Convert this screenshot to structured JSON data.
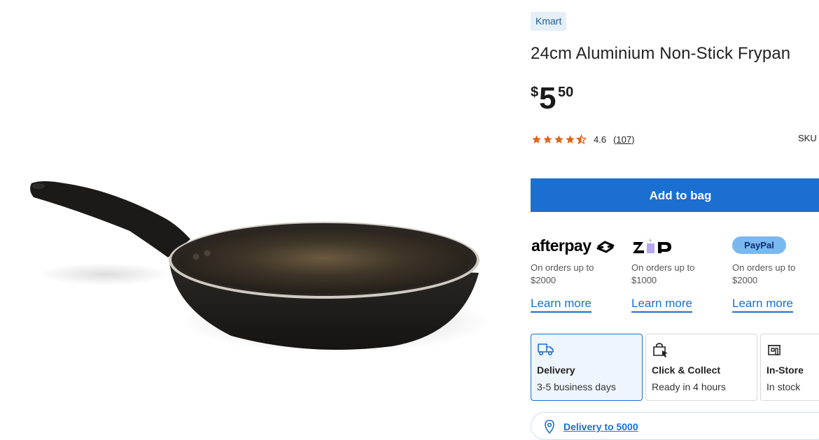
{
  "product": {
    "brand": "Kmart",
    "title": "24cm Aluminium Non-Stick Frypan",
    "price": {
      "currency": "$",
      "dollars": "5",
      "cents": "50"
    },
    "rating": {
      "score": "4.6",
      "count": "(107)",
      "stars": 4.5
    },
    "sku_label": "SKU :",
    "image_alt": "frypan-image"
  },
  "actions": {
    "add_to_bag": "Add to bag"
  },
  "payments": [
    {
      "logo": "afterpay",
      "logo_text": "afterpay",
      "desc": "On orders up to $2000",
      "learn": "Learn more"
    },
    {
      "logo": "zip",
      "logo_text": "zip",
      "desc": "On orders up to $1000",
      "learn": "Learn more"
    },
    {
      "logo": "paypal",
      "logo_text": "PayPal",
      "desc": "On orders up to $2000",
      "learn": "Learn more"
    }
  ],
  "delivery_options": [
    {
      "icon": "truck-icon",
      "title": "Delivery",
      "subtitle": "3-5 business days",
      "selected": true
    },
    {
      "icon": "bag-cursor-icon",
      "title": "Click & Collect",
      "subtitle": "Ready in 4 hours",
      "selected": false
    },
    {
      "icon": "store-icon",
      "title": "In-Store",
      "subtitle": "In stock",
      "selected": false
    }
  ],
  "location": {
    "icon": "location-pin-icon",
    "link": "Delivery to 5000"
  },
  "colors": {
    "primary": "#1b6fd0",
    "star": "#e0641b",
    "tag_bg": "#e6eff8"
  }
}
